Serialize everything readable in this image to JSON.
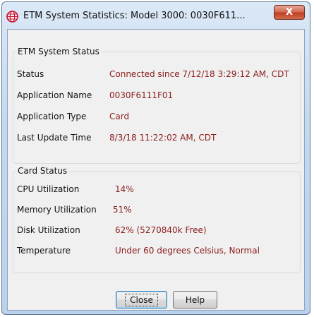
{
  "window": {
    "title": "ETM System Statistics: Model 3000: 0030F611...",
    "close_glyph": "X",
    "app_icon": "globe-icon",
    "accent": "#c13f25"
  },
  "system_status": {
    "legend": "ETM System Status",
    "rows": [
      {
        "label": "Status",
        "value": "Connected since 7/12/18 3:29:12 AM, CDT"
      },
      {
        "label": "Application Name",
        "value": "0030F6111F01"
      },
      {
        "label": "Application Type",
        "value": "Card"
      },
      {
        "label": "Last Update Time",
        "value": "8/3/18 11:22:02 AM, CDT"
      }
    ]
  },
  "card_status": {
    "legend": "Card Status",
    "rows": [
      {
        "label": "CPU Utilization",
        "value": "14%"
      },
      {
        "label": "Memory Utilization",
        "value": "51%"
      },
      {
        "label": "Disk Utilization",
        "value": "62% (5270840k Free)"
      },
      {
        "label": "Temperature",
        "value": "Under 60 degrees Celsius, Normal"
      }
    ]
  },
  "buttons": {
    "close_label": "Close",
    "help_label": "Help"
  },
  "colors": {
    "value_text": "#8b1c1c"
  }
}
